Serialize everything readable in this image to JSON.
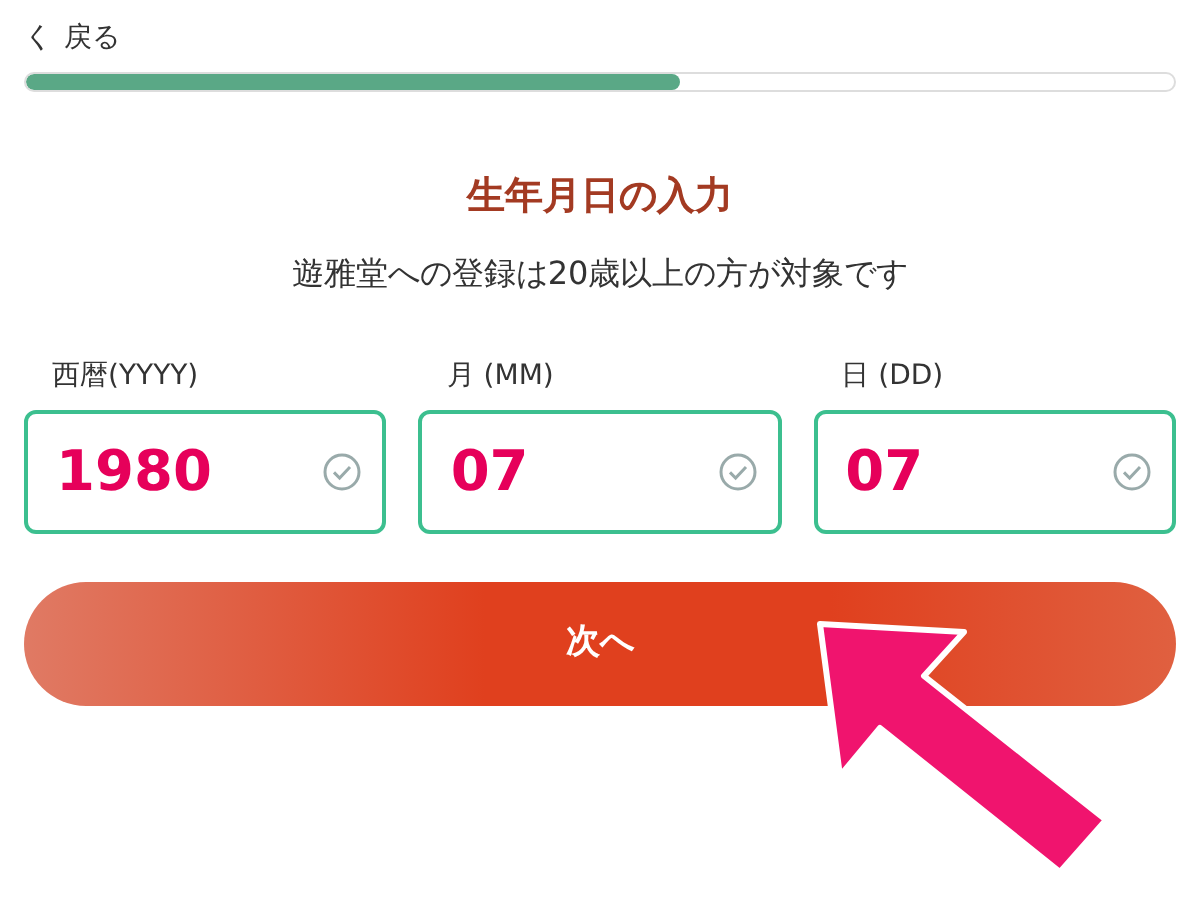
{
  "back_link": {
    "icon": "く",
    "label": "戻る"
  },
  "progress": {
    "level": 0.57
  },
  "title": "生年月日の入力",
  "subtitle": "遊雅堂への登録は20歳以上の方が対象です",
  "fields": [
    {
      "label": "西暦(YYYY)",
      "value": "1980",
      "valid": true
    },
    {
      "label": "月 (MM)",
      "value": "07",
      "valid": true
    },
    {
      "label": "日 (DD)",
      "value": "07",
      "valid": true
    }
  ],
  "next_button": {
    "label": "次へ"
  }
}
